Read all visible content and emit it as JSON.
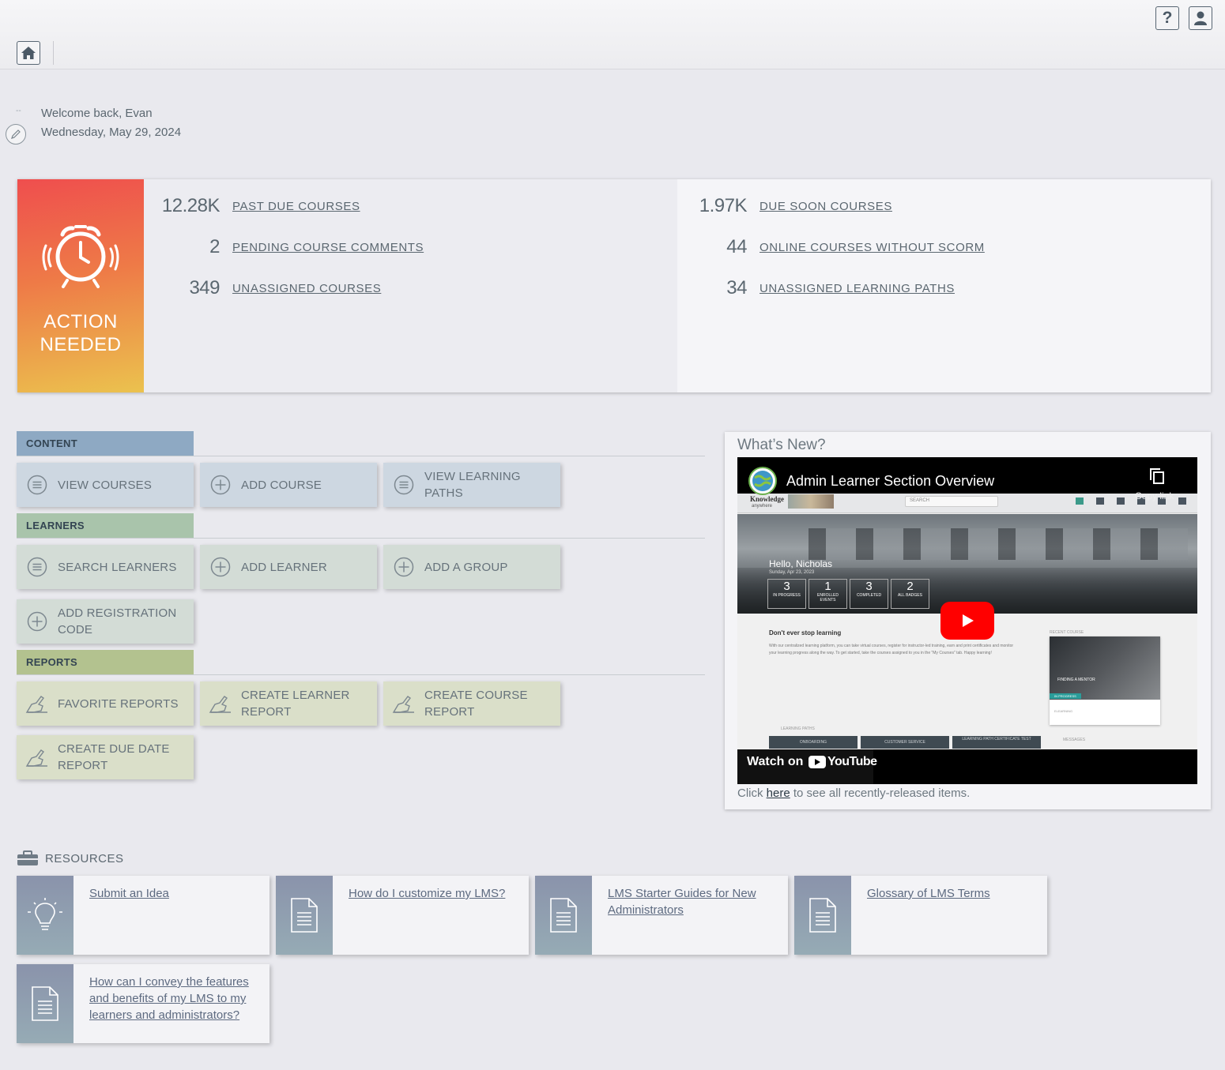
{
  "header": {
    "help_label": "?",
    "welcome": "Welcome back, Evan",
    "date": "Wednesday, May 29, 2024",
    "dash": "--"
  },
  "action": {
    "title_line1": "ACTION",
    "title_line2": "NEEDED",
    "left_stats": [
      {
        "value": "12.28K",
        "label": "PAST DUE COURSES"
      },
      {
        "value": "2",
        "label": "PENDING COURSE COMMENTS"
      },
      {
        "value": "349",
        "label": "UNASSIGNED COURSES"
      }
    ],
    "right_stats": [
      {
        "value": "1.97K",
        "label": "DUE SOON COURSES"
      },
      {
        "value": "44",
        "label": "ONLINE COURSES WITHOUT SCORM"
      },
      {
        "value": "34",
        "label": "UNASSIGNED LEARNING PATHS"
      }
    ]
  },
  "sections": {
    "content": {
      "title": "CONTENT",
      "tiles": [
        "VIEW COURSES",
        "ADD COURSE",
        "VIEW LEARNING PATHS"
      ]
    },
    "learners": {
      "title": "LEARNERS",
      "tiles": [
        "SEARCH LEARNERS",
        "ADD LEARNER",
        "ADD A GROUP",
        "ADD REGISTRATION CODE"
      ]
    },
    "reports": {
      "title": "REPORTS",
      "tiles": [
        "FAVORITE REPORTS",
        "CREATE LEARNER REPORT",
        "CREATE COURSE REPORT",
        "CREATE DUE DATE REPORT"
      ]
    }
  },
  "whats_new": {
    "title": "What’s New?",
    "video_title": "Admin Learner Section Overview",
    "copy_link": "Copy link",
    "watch_on": "Watch on",
    "youtube": "YouTube",
    "video_screen": {
      "brand": "Knowledge",
      "brand_sub": "anywhere",
      "search": "SEARCH",
      "hello": "Hello, Nicholas",
      "hello_date": "Sunday, Apr 23, 2023",
      "stats": [
        {
          "n": "3",
          "l": "IN PROGRESS"
        },
        {
          "n": "1",
          "l": "ENROLLED EVENTS"
        },
        {
          "n": "3",
          "l": "COMPLETED"
        },
        {
          "n": "2",
          "l": "ALL BADGES"
        }
      ],
      "headline": "Don't ever stop learning",
      "body": "With our centralized learning platform, you can take virtual courses, register for instructor-led training, earn and print certificates and monitor your learning progress along the way. To get started, take the courses assigned to you in the \"My Courses\" tab. Happy learning!",
      "recent_course": "RECENT COURSE",
      "mentor": "FINDING A MENTOR",
      "in_progress": "IN PROGRESS",
      "elearning": "ELEARNING",
      "learning_paths": "LEARNING PATHS",
      "path_tabs": [
        "ONBOARDING",
        "CUSTOMER SERVICE",
        "LEARNING PATH CERTIFICATE TEST"
      ],
      "messages": "MESSAGES"
    },
    "footer_pre": "Click ",
    "footer_link": "here",
    "footer_post": " to see all recently-released items."
  },
  "resources": {
    "title": "RESOURCES",
    "items": [
      {
        "label": "Submit an Idea",
        "icon": "lightbulb-icon"
      },
      {
        "label": "How do I customize my LMS?",
        "icon": "document-icon"
      },
      {
        "label": "LMS Starter Guides for New Administrators",
        "icon": "document-icon"
      },
      {
        "label": "Glossary of LMS Terms",
        "icon": "document-icon"
      },
      {
        "label": "How can I convey the features and benefits of my LMS to my learners and administrators?",
        "icon": "document-icon"
      }
    ]
  },
  "colors": {
    "content": "#8ea9c3",
    "learners": "#a9c4ab",
    "reports": "#b3c28f",
    "accent_gradient_start": "#ef4e4e",
    "accent_gradient_end": "#ebc24e"
  }
}
